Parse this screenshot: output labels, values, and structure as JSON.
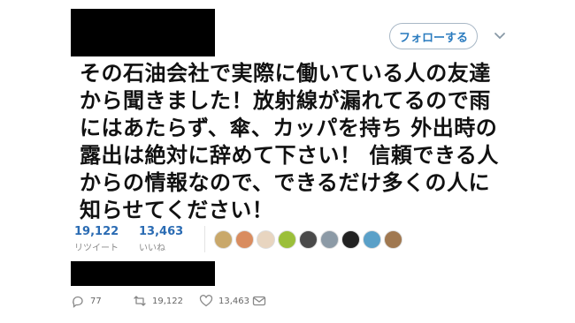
{
  "header": {
    "follow_label": "フォローする"
  },
  "tweet": {
    "lines": [
      "その石油会社で実際に働いている人の友達",
      "から聞きました！放射線が漏れてるので雨",
      "にはあたらず、傘、カッパを持ち 外出時の",
      "露出は絶対に辞めて下さい！ 信頼できる人",
      "からの情報なので、できるだけ多くの人に",
      "知らせてください！"
    ]
  },
  "stats": {
    "retweets": {
      "value": "19,122",
      "label": "リツイート"
    },
    "likes": {
      "value": "13,463",
      "label": "いいね"
    }
  },
  "avatars": [
    {
      "name": "avatar-1",
      "color": "#c9a86a"
    },
    {
      "name": "avatar-2",
      "color": "#d98c5f"
    },
    {
      "name": "avatar-3",
      "color": "#e8d5c0"
    },
    {
      "name": "avatar-4",
      "color": "#9bbf3a"
    },
    {
      "name": "avatar-5",
      "color": "#4a4a4a"
    },
    {
      "name": "avatar-6",
      "color": "#8c9aa6"
    },
    {
      "name": "avatar-7",
      "color": "#222222"
    },
    {
      "name": "avatar-8",
      "color": "#5aa0c8"
    },
    {
      "name": "avatar-9",
      "color": "#a07850"
    }
  ],
  "actions": {
    "reply_count": "77",
    "retweet_count": "19,122",
    "like_count": "13,463"
  },
  "colors": {
    "accent": "#2a7bbf",
    "stat_number": "#2a6bb3",
    "redaction": "#000000"
  },
  "icons": [
    "chevron-down-icon",
    "reply-icon",
    "retweet-icon",
    "like-icon",
    "dm-icon"
  ]
}
